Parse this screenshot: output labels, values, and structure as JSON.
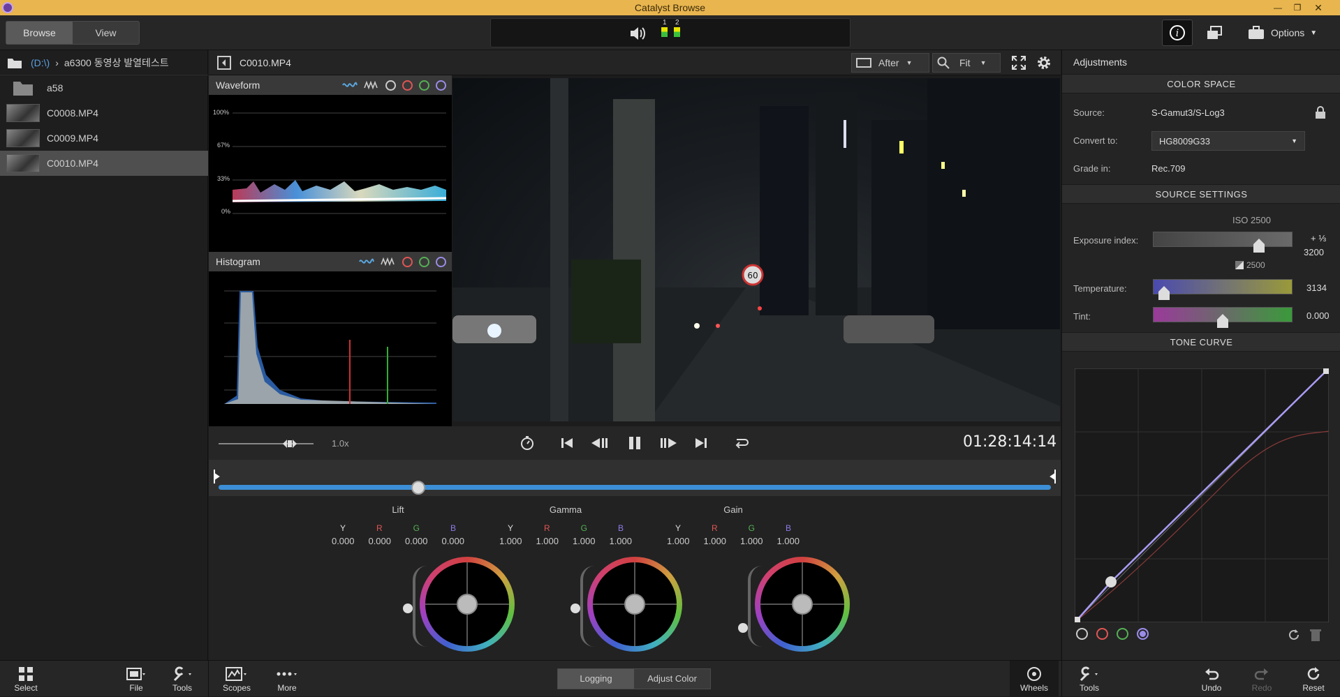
{
  "window": {
    "title": "Catalyst Browse"
  },
  "topbar": {
    "tabs": [
      {
        "label": "Browse",
        "active": true
      },
      {
        "label": "View",
        "active": false
      }
    ],
    "meters": [
      "1",
      "2"
    ],
    "options_label": "Options"
  },
  "browser": {
    "drive": "(D:\\)",
    "folder": "a6300 동영상 발열테스트",
    "items": [
      {
        "name": "a58",
        "type": "folder"
      },
      {
        "name": "C0008.MP4",
        "type": "clip"
      },
      {
        "name": "C0009.MP4",
        "type": "clip"
      },
      {
        "name": "C0010.MP4",
        "type": "clip",
        "selected": true
      }
    ]
  },
  "viewer": {
    "clip_name": "C0010.MP4",
    "compare_mode": "After",
    "zoom": "Fit"
  },
  "scopes": {
    "waveform": {
      "title": "Waveform",
      "scale": [
        "100%",
        "67%",
        "33%",
        "0%"
      ]
    },
    "histogram": {
      "title": "Histogram"
    }
  },
  "transport": {
    "speed": "1.0x",
    "timecode": "01:28:14:14",
    "playhead_fraction": 0.24
  },
  "wheels": [
    {
      "title": "Lift",
      "channels": [
        "Y",
        "R",
        "G",
        "B"
      ],
      "values": [
        "0.000",
        "0.000",
        "0.000",
        "0.000"
      ]
    },
    {
      "title": "Gamma",
      "channels": [
        "Y",
        "R",
        "G",
        "B"
      ],
      "values": [
        "1.000",
        "1.000",
        "1.000",
        "1.000"
      ]
    },
    {
      "title": "Gain",
      "channels": [
        "Y",
        "R",
        "G",
        "B"
      ],
      "values": [
        "1.000",
        "1.000",
        "1.000",
        "1.000"
      ]
    }
  ],
  "adjustments": {
    "title": "Adjustments",
    "color_space": {
      "header": "COLOR SPACE",
      "source_label": "Source:",
      "source_value": "S-Gamut3/S-Log3",
      "convert_label": "Convert to:",
      "convert_value": "HG8009G33",
      "grade_label": "Grade in:",
      "grade_value": "Rec.709"
    },
    "source_settings": {
      "header": "SOURCE SETTINGS",
      "iso_label": "ISO 2500",
      "exposure_label": "Exposure index:",
      "exposure_step": "+ ⅓",
      "exposure_value": "3200",
      "exposure_base": "2500",
      "temperature_label": "Temperature:",
      "temperature_value": "3134",
      "tint_label": "Tint:",
      "tint_value": "0.000"
    },
    "tone_curve": {
      "header": "TONE CURVE"
    }
  },
  "bottombar": {
    "left": [
      {
        "label": "Select",
        "icon": "grid-icon"
      },
      {
        "label": "File",
        "icon": "film-icon"
      },
      {
        "label": "Tools",
        "icon": "wrench-icon"
      },
      {
        "label": "Scopes",
        "icon": "scope-icon"
      },
      {
        "label": "More",
        "icon": "dots-icon"
      }
    ],
    "modes": [
      {
        "label": "Logging",
        "active": true
      },
      {
        "label": "Adjust Color",
        "active": false
      }
    ],
    "wheels_label": "Wheels",
    "right": [
      {
        "label": "Tools",
        "icon": "wrench-icon"
      },
      {
        "label": "Undo",
        "icon": "undo-icon"
      },
      {
        "label": "Redo",
        "icon": "redo-icon"
      },
      {
        "label": "Reset",
        "icon": "reset-icon"
      }
    ]
  },
  "colors": {
    "titlebar": "#e8b54f",
    "timeline_accent": "#3c8fd6",
    "curve": "#a99cf5"
  }
}
